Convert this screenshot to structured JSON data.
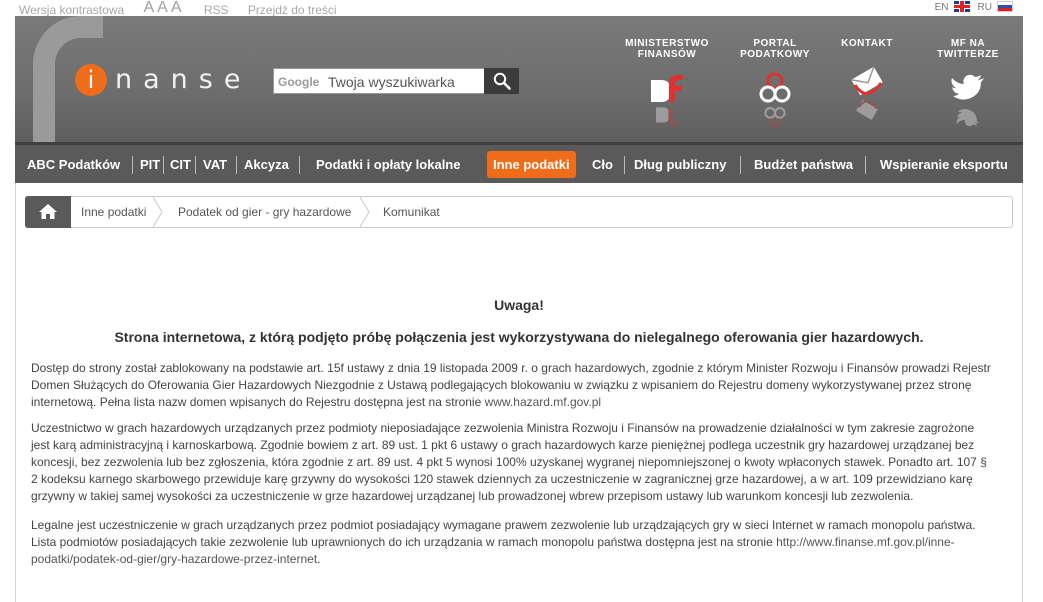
{
  "topbar": {
    "contrast": "Wersja kontrastowa",
    "font_sizes": "AAA",
    "rss": "RSS",
    "skip": "Przejdź do treści",
    "lang_en": "EN",
    "lang_ru": "RU"
  },
  "header": {
    "logo_i": "i",
    "logo_text": "nanse",
    "search_brand": "Google",
    "search_placeholder": "Twoja wyszukiwarka",
    "links": [
      {
        "line1": "MINISTERSTWO",
        "line2": "FINANSÓW",
        "icon": "mf-logo-icon"
      },
      {
        "line1": "PORTAL",
        "line2": "PODATKOWY",
        "icon": "portal-rings-icon"
      },
      {
        "line1": "KONTAKT",
        "line2": "",
        "icon": "envelope-icon"
      },
      {
        "line1": "MF NA",
        "line2": "TWITTERZE",
        "icon": "twitter-bird-icon"
      }
    ]
  },
  "nav": {
    "items": [
      "ABC Podatków",
      "PIT",
      "CIT",
      "VAT",
      "Akcyza",
      "Podatki i opłaty lokalne",
      "Inne podatki",
      "Cło",
      "Dług publiczny",
      "Budżet państwa",
      "Wspieranie eksportu"
    ],
    "active": "Inne podatki"
  },
  "breadcrumb": [
    "Inne podatki",
    "Podatek od gier - gry hazardowe",
    "Komunikat"
  ],
  "content": {
    "title": "Uwaga!",
    "headline": "Strona internetowa, z którą podjęto próbę połączenia jest wykorzystywana do nielegalnego oferowania gier hazardowych.",
    "p1_lines": [
      "Dostęp do strony został zablokowany na podstawie art. 15f ustawy z dnia 19 listopada 2009 r. o grach hazardowych, zgodnie z którym Minister Rozwoju i Finansów prowadzi Rejestr",
      "Domen Służących do Oferowania Gier Hazardowych Niezgodnie z Ustawą podlegających blokowaniu w związku z wpisaniem do Rejestru domeny wykorzystywanej przez stronę",
      "internetową. Pełna lista nazw domen wpisanych do Rejestru dostępna jest na stronie "
    ],
    "p1_link": "www.hazard.mf.gov.pl",
    "p2_lines": [
      "Uczestnictwo w grach hazardowych urządzanych przez podmioty nieposiadające zezwolenia Ministra Rozwoju i Finansów na prowadzenie działalności w tym zakresie zagrożone",
      "jest karą administracyjną i karnoskarbową. Zgodnie bowiem z art. 89 ust. 1 pkt 6 ustawy o grach hazardowych karze pieniężnej podlega uczestnik gry hazardowej urządzanej bez",
      "koncesji, bez zezwolenia lub bez zgłoszenia, która  zgodnie z art. 89 ust. 4 pkt 5 wynosi 100% uzyskanej wygranej niepomniejszonej o kwoty wpłaconych stawek. Ponadto art. 107 §",
      "2 kodeksu karnego skarbowego przewiduje karę grzywny do wysokości 120 stawek dziennych za uczestniczenie w zagranicznej grze hazardowej, a w art. 109 przewidziano karę",
      "grzywny w takiej samej wysokości za uczestniczenie w grze hazardowej urządzanej lub prowadzonej wbrew przepisom ustawy lub warunkom koncesji lub zezwolenia."
    ],
    "p3_lines": [
      "Legalne jest uczestniczenie w grach urządzanych przez podmiot posiadający wymagane prawem zezwolenie lub urządzających gry w sieci Internet w ramach monopolu państwa.",
      "Lista podmiotów posiadających takie zezwolenie lub uprawnionych do ich urządzania w ramach monopolu państwa dostępna jest na stronie "
    ],
    "p3_link_a": "http://www.finanse.mf.gov.pl/inne-",
    "p3_link_b": "podatki/podatek-od-gier/gry-hazardowe-przez-internet",
    "p3_end": "."
  },
  "colors": {
    "accent": "#ef6c1b",
    "header_bg": "#6d6d6d",
    "nav_bg": "#5a5a5a"
  }
}
